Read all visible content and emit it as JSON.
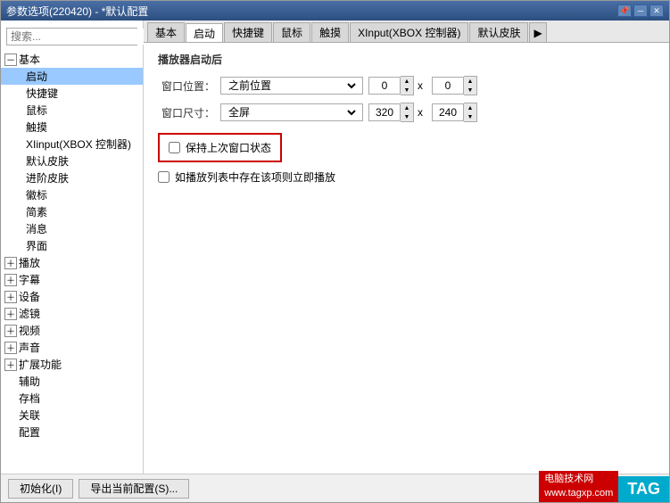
{
  "window": {
    "title": "参数选项(220420) - *默认配置",
    "title_controls": {
      "pin": "📌",
      "minimize": "－",
      "close": "✕"
    }
  },
  "sidebar": {
    "search_placeholder": "搜索...",
    "tree": [
      {
        "label": "基本",
        "type": "root-expanded",
        "selected": false
      },
      {
        "label": "启动",
        "type": "child",
        "selected": true
      },
      {
        "label": "快捷键",
        "type": "child"
      },
      {
        "label": "鼠标",
        "type": "child"
      },
      {
        "label": "触摸",
        "type": "child"
      },
      {
        "label": "XIinput(XBOX 控制器)",
        "type": "child"
      },
      {
        "label": "默认皮肤",
        "type": "child"
      },
      {
        "label": "进阶皮肤",
        "type": "child"
      },
      {
        "label": "徽标",
        "type": "child"
      },
      {
        "label": "简素",
        "type": "child"
      },
      {
        "label": "消息",
        "type": "child"
      },
      {
        "label": "界面",
        "type": "child"
      },
      {
        "label": "播放",
        "type": "root-collapsed"
      },
      {
        "label": "字幕",
        "type": "root-collapsed"
      },
      {
        "label": "设备",
        "type": "root-collapsed"
      },
      {
        "label": "滤镜",
        "type": "root-collapsed"
      },
      {
        "label": "视频",
        "type": "root-collapsed"
      },
      {
        "label": "声音",
        "type": "root-collapsed"
      },
      {
        "label": "扩展功能",
        "type": "root-collapsed"
      },
      {
        "label": "辅助",
        "type": "leaf"
      },
      {
        "label": "存档",
        "type": "leaf"
      },
      {
        "label": "关联",
        "type": "leaf"
      },
      {
        "label": "配置",
        "type": "leaf"
      }
    ]
  },
  "tabs": {
    "items": [
      {
        "label": "基本",
        "active": false
      },
      {
        "label": "启动",
        "active": true
      },
      {
        "label": "快捷键",
        "active": false
      },
      {
        "label": "鼠标",
        "active": false
      },
      {
        "label": "触摸",
        "active": false
      },
      {
        "label": "XInput(XBOX 控制器)",
        "active": false
      },
      {
        "label": "默认皮肤",
        "active": false
      }
    ],
    "more_arrow": "▶"
  },
  "main": {
    "section_title": "播放器启动后",
    "window_position_label": "窗口位置：",
    "window_position_value": "之前位置",
    "window_size_label": "窗口尺寸：",
    "window_size_value": "全屏",
    "spinners": {
      "pos_x": "0",
      "pos_y": "0",
      "size_x": "320",
      "size_y": "240"
    },
    "x_label1": "x",
    "x_label2": "x",
    "checkbox1_label": "保持上次窗口状态",
    "checkbox1_checked": false,
    "checkbox2_label": "如播放列表中存在该项则立即播放",
    "checkbox2_checked": false
  },
  "footer": {
    "init_btn": "初始化(I)",
    "export_btn": "导出当前配置(S)...",
    "watermark_line1": "电脑技术网",
    "watermark_line2": "www.tagxp.com",
    "watermark_tag": "TAG"
  }
}
